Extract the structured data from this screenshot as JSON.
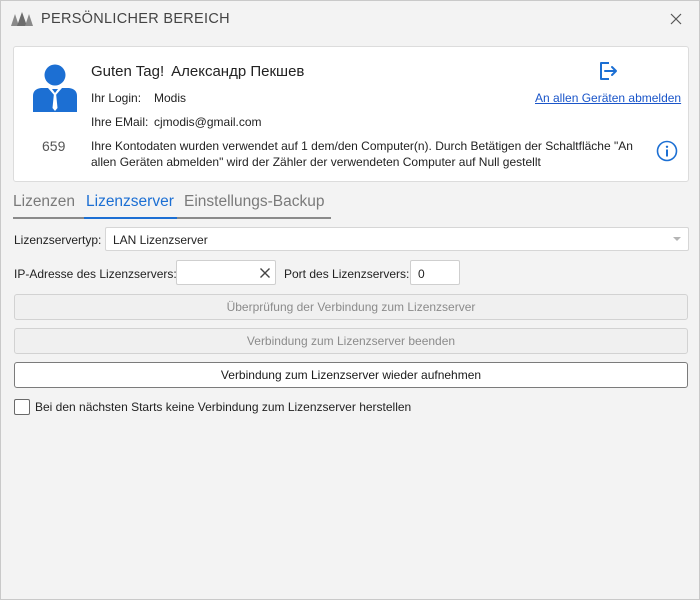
{
  "window": {
    "title": "PERSÖNLICHER BEREICH"
  },
  "account": {
    "greeting": "Guten Tag!",
    "user_name": "Александр Пекшев",
    "login_label": "Ihr Login:",
    "login_value": "Modis",
    "email_label": "Ihre EMail:",
    "email_value": "cjmodis@gmail.com",
    "counter": "659",
    "info_text": "Ihre Kontodaten wurden verwendet auf 1 dem/den Computer(n). Durch Betätigen der Schaltfläche \"An allen Geräten abmelden\" wird der Zähler der verwendeten Computer auf Null gestellt",
    "logout_all_link": "An allen Geräten abmelden"
  },
  "tabs": [
    {
      "label": "Lizenzen",
      "active": false
    },
    {
      "label": "Lizenzserver",
      "active": true
    },
    {
      "label": "Einstellungs-Backup",
      "active": false
    }
  ],
  "form": {
    "server_type_label": "Lizenzservertyp:",
    "server_type_value": "LAN Lizenzserver",
    "ip_label": "IP-Adresse des Lizenzservers:",
    "ip_value": "",
    "port_label": "Port des Lizenzservers:",
    "port_value": "0",
    "buttons": {
      "check_connection": "Überprüfung der Verbindung zum Lizenzserver",
      "end_connection": "Verbindung zum Lizenzserver beenden",
      "resume_connection": "Verbindung zum Lizenzserver wieder aufnehmen"
    },
    "no_connect_checkbox_label": "Bei den nächsten Starts keine Verbindung zum Lizenzserver herstellen",
    "no_connect_checked": false
  },
  "colors": {
    "accent": "#1c6fd3",
    "link": "#1a55c9",
    "avatar": "#1c6fd3"
  },
  "icons": {
    "logo": "app-logo",
    "close": "close-icon",
    "avatar": "user-avatar-icon",
    "logout": "logout-icon",
    "info": "info-icon",
    "clear": "clear-icon",
    "dropdown": "chevron-down-icon"
  }
}
